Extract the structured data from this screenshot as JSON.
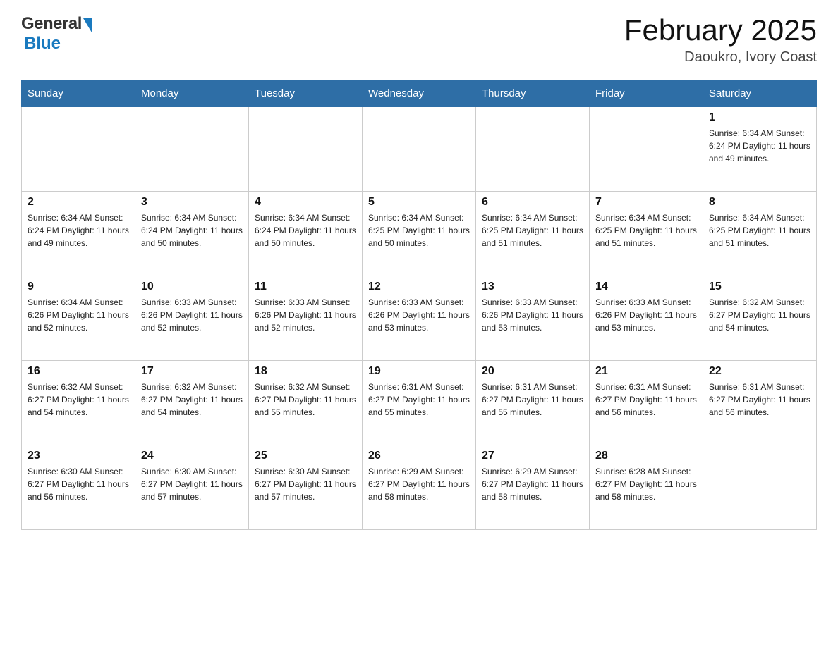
{
  "header": {
    "title": "February 2025",
    "subtitle": "Daoukro, Ivory Coast"
  },
  "weekdays": [
    "Sunday",
    "Monday",
    "Tuesday",
    "Wednesday",
    "Thursday",
    "Friday",
    "Saturday"
  ],
  "weeks": [
    [
      {
        "day": "",
        "info": ""
      },
      {
        "day": "",
        "info": ""
      },
      {
        "day": "",
        "info": ""
      },
      {
        "day": "",
        "info": ""
      },
      {
        "day": "",
        "info": ""
      },
      {
        "day": "",
        "info": ""
      },
      {
        "day": "1",
        "info": "Sunrise: 6:34 AM\nSunset: 6:24 PM\nDaylight: 11 hours\nand 49 minutes."
      }
    ],
    [
      {
        "day": "2",
        "info": "Sunrise: 6:34 AM\nSunset: 6:24 PM\nDaylight: 11 hours\nand 49 minutes."
      },
      {
        "day": "3",
        "info": "Sunrise: 6:34 AM\nSunset: 6:24 PM\nDaylight: 11 hours\nand 50 minutes."
      },
      {
        "day": "4",
        "info": "Sunrise: 6:34 AM\nSunset: 6:24 PM\nDaylight: 11 hours\nand 50 minutes."
      },
      {
        "day": "5",
        "info": "Sunrise: 6:34 AM\nSunset: 6:25 PM\nDaylight: 11 hours\nand 50 minutes."
      },
      {
        "day": "6",
        "info": "Sunrise: 6:34 AM\nSunset: 6:25 PM\nDaylight: 11 hours\nand 51 minutes."
      },
      {
        "day": "7",
        "info": "Sunrise: 6:34 AM\nSunset: 6:25 PM\nDaylight: 11 hours\nand 51 minutes."
      },
      {
        "day": "8",
        "info": "Sunrise: 6:34 AM\nSunset: 6:25 PM\nDaylight: 11 hours\nand 51 minutes."
      }
    ],
    [
      {
        "day": "9",
        "info": "Sunrise: 6:34 AM\nSunset: 6:26 PM\nDaylight: 11 hours\nand 52 minutes."
      },
      {
        "day": "10",
        "info": "Sunrise: 6:33 AM\nSunset: 6:26 PM\nDaylight: 11 hours\nand 52 minutes."
      },
      {
        "day": "11",
        "info": "Sunrise: 6:33 AM\nSunset: 6:26 PM\nDaylight: 11 hours\nand 52 minutes."
      },
      {
        "day": "12",
        "info": "Sunrise: 6:33 AM\nSunset: 6:26 PM\nDaylight: 11 hours\nand 53 minutes."
      },
      {
        "day": "13",
        "info": "Sunrise: 6:33 AM\nSunset: 6:26 PM\nDaylight: 11 hours\nand 53 minutes."
      },
      {
        "day": "14",
        "info": "Sunrise: 6:33 AM\nSunset: 6:26 PM\nDaylight: 11 hours\nand 53 minutes."
      },
      {
        "day": "15",
        "info": "Sunrise: 6:32 AM\nSunset: 6:27 PM\nDaylight: 11 hours\nand 54 minutes."
      }
    ],
    [
      {
        "day": "16",
        "info": "Sunrise: 6:32 AM\nSunset: 6:27 PM\nDaylight: 11 hours\nand 54 minutes."
      },
      {
        "day": "17",
        "info": "Sunrise: 6:32 AM\nSunset: 6:27 PM\nDaylight: 11 hours\nand 54 minutes."
      },
      {
        "day": "18",
        "info": "Sunrise: 6:32 AM\nSunset: 6:27 PM\nDaylight: 11 hours\nand 55 minutes."
      },
      {
        "day": "19",
        "info": "Sunrise: 6:31 AM\nSunset: 6:27 PM\nDaylight: 11 hours\nand 55 minutes."
      },
      {
        "day": "20",
        "info": "Sunrise: 6:31 AM\nSunset: 6:27 PM\nDaylight: 11 hours\nand 55 minutes."
      },
      {
        "day": "21",
        "info": "Sunrise: 6:31 AM\nSunset: 6:27 PM\nDaylight: 11 hours\nand 56 minutes."
      },
      {
        "day": "22",
        "info": "Sunrise: 6:31 AM\nSunset: 6:27 PM\nDaylight: 11 hours\nand 56 minutes."
      }
    ],
    [
      {
        "day": "23",
        "info": "Sunrise: 6:30 AM\nSunset: 6:27 PM\nDaylight: 11 hours\nand 56 minutes."
      },
      {
        "day": "24",
        "info": "Sunrise: 6:30 AM\nSunset: 6:27 PM\nDaylight: 11 hours\nand 57 minutes."
      },
      {
        "day": "25",
        "info": "Sunrise: 6:30 AM\nSunset: 6:27 PM\nDaylight: 11 hours\nand 57 minutes."
      },
      {
        "day": "26",
        "info": "Sunrise: 6:29 AM\nSunset: 6:27 PM\nDaylight: 11 hours\nand 58 minutes."
      },
      {
        "day": "27",
        "info": "Sunrise: 6:29 AM\nSunset: 6:27 PM\nDaylight: 11 hours\nand 58 minutes."
      },
      {
        "day": "28",
        "info": "Sunrise: 6:28 AM\nSunset: 6:27 PM\nDaylight: 11 hours\nand 58 minutes."
      },
      {
        "day": "",
        "info": ""
      }
    ]
  ]
}
